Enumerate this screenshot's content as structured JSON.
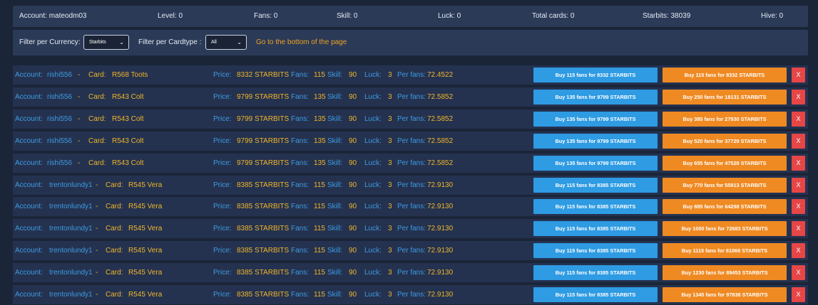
{
  "stats": {
    "account": "Account: mateodm03",
    "level": "Level: 0",
    "fans": "Fans: 0",
    "skill": "Skill: 0",
    "luck": "Luck: 0",
    "total_cards": "Total cards: 0",
    "starbits": "Starbits: 38039",
    "hive": "Hive: 0"
  },
  "filters": {
    "currency_label": "Filter per Currency:",
    "currency_value": "Starbits",
    "cardtype_label": "Filter per Cardtype :",
    "cardtype_value": "All",
    "goto_link": "Go to the bottom of the page"
  },
  "labels": {
    "account": "Account:",
    "dash": "-",
    "card": "Card:",
    "price": "Price:",
    "fans": "Fans:",
    "skill": "Skill:",
    "luck": "Luck:",
    "per_fans": "Per fans:",
    "remove": "X"
  },
  "colors": {
    "label": "#3f9be0",
    "value": "#f0b52a",
    "buy_single": "#2e9be3",
    "buy_cumulative": "#ef8a23",
    "remove": "#e64646"
  },
  "listings": [
    {
      "account": "rishi556",
      "card": "R568 Toots",
      "price": "8332 STARBITS",
      "fans": "115",
      "skill": "90",
      "luck": "3",
      "per_fans": "72.4522",
      "buy_single": "Buy 115 fans for 8332 STARBITS",
      "buy_cumulative": "Buy 115 fans for 8332 STARBITS"
    },
    {
      "account": "rishi556",
      "card": "R543 Colt",
      "price": "9799 STARBITS",
      "fans": "135",
      "skill": "90",
      "luck": "3",
      "per_fans": "72.5852",
      "buy_single": "Buy 135 fans for 9799 STARBITS",
      "buy_cumulative": "Buy 250 fans for 18131 STARBITS"
    },
    {
      "account": "rishi556",
      "card": "R543 Colt",
      "price": "9799 STARBITS",
      "fans": "135",
      "skill": "90",
      "luck": "3",
      "per_fans": "72.5852",
      "buy_single": "Buy 135 fans for 9799 STARBITS",
      "buy_cumulative": "Buy 385 fans for 27930 STARBITS"
    },
    {
      "account": "rishi556",
      "card": "R543 Colt",
      "price": "9799 STARBITS",
      "fans": "135",
      "skill": "90",
      "luck": "3",
      "per_fans": "72.5852",
      "buy_single": "Buy 135 fans for 9799 STARBITS",
      "buy_cumulative": "Buy 520 fans for 37729 STARBITS"
    },
    {
      "account": "rishi556",
      "card": "R543 Colt",
      "price": "9799 STARBITS",
      "fans": "135",
      "skill": "90",
      "luck": "3",
      "per_fans": "72.5852",
      "buy_single": "Buy 135 fans for 9799 STARBITS",
      "buy_cumulative": "Buy 655 fans for 47528 STARBITS"
    },
    {
      "account": "trentonlundy1",
      "card": "R545 Vera",
      "price": "8385 STARBITS",
      "fans": "115",
      "skill": "90",
      "luck": "3",
      "per_fans": "72.9130",
      "buy_single": "Buy 115 fans for 8385 STARBITS",
      "buy_cumulative": "Buy 770 fans for 55913 STARBITS"
    },
    {
      "account": "trentonlundy1",
      "card": "R545 Vera",
      "price": "8385 STARBITS",
      "fans": "115",
      "skill": "90",
      "luck": "3",
      "per_fans": "72.9130",
      "buy_single": "Buy 115 fans for 8385 STARBITS",
      "buy_cumulative": "Buy 885 fans for 64298 STARBITS"
    },
    {
      "account": "trentonlundy1",
      "card": "R545 Vera",
      "price": "8385 STARBITS",
      "fans": "115",
      "skill": "90",
      "luck": "3",
      "per_fans": "72.9130",
      "buy_single": "Buy 115 fans for 8385 STARBITS",
      "buy_cumulative": "Buy 1000 fans for 72683 STARBITS"
    },
    {
      "account": "trentonlundy1",
      "card": "R545 Vera",
      "price": "8385 STARBITS",
      "fans": "115",
      "skill": "90",
      "luck": "3",
      "per_fans": "72.9130",
      "buy_single": "Buy 115 fans for 8385 STARBITS",
      "buy_cumulative": "Buy 1115 fans for 81068 STARBITS"
    },
    {
      "account": "trentonlundy1",
      "card": "R545 Vera",
      "price": "8385 STARBITS",
      "fans": "115",
      "skill": "90",
      "luck": "3",
      "per_fans": "72.9130",
      "buy_single": "Buy 115 fans for 8385 STARBITS",
      "buy_cumulative": "Buy 1230 fans for 89453 STARBITS"
    },
    {
      "account": "trentonlundy1",
      "card": "R545 Vera",
      "price": "8385 STARBITS",
      "fans": "115",
      "skill": "90",
      "luck": "3",
      "per_fans": "72.9130",
      "buy_single": "Buy 115 fans for 8385 STARBITS",
      "buy_cumulative": "Buy 1345 fans for 97838 STARBITS"
    }
  ]
}
